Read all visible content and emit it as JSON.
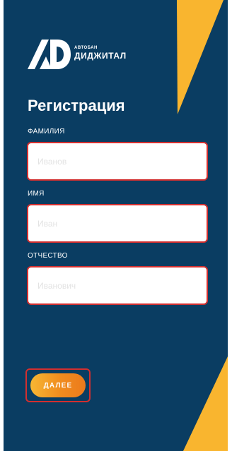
{
  "brand": {
    "top_text": "АВТОБАН",
    "name": "ДИДЖИТАЛ"
  },
  "page": {
    "title": "Регистрация"
  },
  "form": {
    "fields": [
      {
        "label": "ФАМИЛИЯ",
        "placeholder": "Иванов",
        "value": ""
      },
      {
        "label": "ИМЯ",
        "placeholder": "Иван",
        "value": ""
      },
      {
        "label": "ОТЧЕСТВО",
        "placeholder": "Иванович",
        "value": ""
      }
    ],
    "next_label": "ДАЛЕЕ"
  },
  "colors": {
    "background": "#0a3d62",
    "accent": "#f9b52f",
    "highlight_border": "#d32f2f",
    "button_start": "#f7b733",
    "button_end": "#ec7a1c"
  }
}
